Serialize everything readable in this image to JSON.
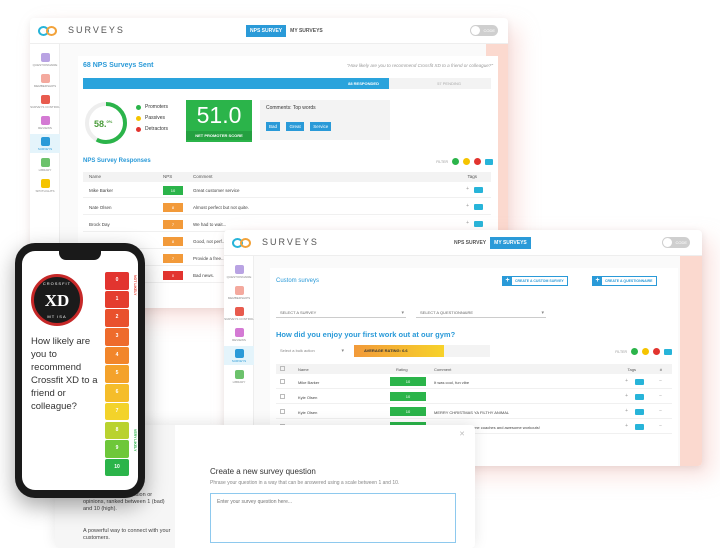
{
  "colors": {
    "accent": "#2a9ad8",
    "promoters": "#2bb44a",
    "passives": "#f5c400",
    "detractors": "#e2342f",
    "logo_blue": "#27b4d9",
    "logo_orange": "#f2a23a"
  },
  "window1": {
    "app_title": "SURVEYS",
    "tabs": [
      {
        "label": "NPS SURVEY",
        "active": true
      },
      {
        "label": "MY SURVEYS",
        "active": false
      }
    ],
    "toggle_label": "CODE",
    "sidebar": [
      {
        "label": "QUESTIONNAIRE",
        "icon": "plus-icon",
        "color": "#b9a3e3"
      },
      {
        "label": "MEMBERSHIPS",
        "icon": "users-icon",
        "color": "#f4a99e"
      },
      {
        "label": "SURVEYS CONTROL",
        "icon": "pdf-icon",
        "color": "#e85b4e"
      },
      {
        "label": "REVIEWS",
        "icon": "thumbs-up-icon",
        "color": "#d47ad4"
      },
      {
        "label": "SURVEYS",
        "icon": "chart-icon",
        "color": "#2a9ad8",
        "active": true
      },
      {
        "label": "LIBRARY",
        "icon": "refresh-icon",
        "color": "#6cc26c"
      },
      {
        "label": "SPOTLIGHTS",
        "icon": "star-icon",
        "color": "#f5c400"
      }
    ],
    "sent_title": "68 NPS Surveys Sent",
    "question": "\"How likely are you to recommend Crossfit XD to a friend or colleague?\"",
    "responded_label": "88 RESPONDED",
    "pending_label": "57 PENDING",
    "responded_fraction": 0.75,
    "gauge_value": "58.",
    "gauge_sup": "0%",
    "gauge_fraction": 0.58,
    "legend": [
      {
        "label": "Promoters",
        "color": "#2bb44a"
      },
      {
        "label": "Passives",
        "color": "#f5c400"
      },
      {
        "label": "Detractors",
        "color": "#e2342f"
      }
    ],
    "nps_value": "51.0",
    "nps_label": "NET PROMOTER SCORE",
    "words_title": "Comments: Top words",
    "words": [
      "Bad",
      "Great",
      "Service"
    ],
    "responses_title": "NPS Survey Responses",
    "filter_label": "FILTER",
    "columns": {
      "name": "Name",
      "nps": "NPS",
      "comment": "Comment",
      "tags": "Tags"
    },
    "rows": [
      {
        "name": "Mike Barker",
        "score": "10",
        "color": "#2bb44a",
        "comment": "Great customer service"
      },
      {
        "name": "Nate Olsen",
        "score": "8",
        "color": "#f29a3a",
        "comment": "Almost perfect but not quite."
      },
      {
        "name": "Brock Day",
        "score": "7",
        "color": "#f29a3a",
        "comment": "We had to wait..."
      },
      {
        "name": "",
        "score": "8",
        "color": "#f29a3a",
        "comment": "Good, not perf..."
      },
      {
        "name": "",
        "score": "7",
        "color": "#f29a3a",
        "comment": "Provide a free..."
      },
      {
        "name": "",
        "score": "0",
        "color": "#e2342f",
        "comment": "Bad news."
      }
    ]
  },
  "window2": {
    "app_title": "SURVEYS",
    "tabs": [
      {
        "label": "NPS SURVEY",
        "active": false
      },
      {
        "label": "MY SURVEYS",
        "active": true
      }
    ],
    "toggle_label": "CODE",
    "sidebar": [
      {
        "label": "QUESTIONNAIRE",
        "icon": "plus-icon",
        "color": "#b9a3e3"
      },
      {
        "label": "MEMBERSHIPS",
        "icon": "users-icon",
        "color": "#f4a99e"
      },
      {
        "label": "SURVEYS CONTROL",
        "icon": "pdf-icon",
        "color": "#e85b4e"
      },
      {
        "label": "REVIEWS",
        "icon": "thumbs-up-icon",
        "color": "#d47ad4"
      },
      {
        "label": "SURVEYS",
        "icon": "chart-icon",
        "color": "#2a9ad8",
        "active": true
      },
      {
        "label": "LIBRARY",
        "icon": "refresh-icon",
        "color": "#6cc26c"
      }
    ],
    "title": "Custom surveys",
    "create_survey": "CREATE A CUSTOM SURVEY",
    "create_questionnaire": "CREATE A QUESTIONNAIRE",
    "select_survey": "SELECT A SURVEY",
    "select_questionnaire": "SELECT A QUESTIONNAIRE",
    "question": "How did you enjoy your first work out at our gym?",
    "bulk_action": "Select a bulk action",
    "average_label": "AVERAGE RATING: 6.6",
    "average_fraction": 0.66,
    "filter_label": "FILTER",
    "columns": {
      "name": "Name",
      "rating": "Rating",
      "comment": "Comment",
      "tags": "Tags",
      "more": "#"
    },
    "rows": [
      {
        "name": "Mike Barker",
        "rating": "10",
        "comment": "It was cool, fun vibe"
      },
      {
        "name": "Kyle Olsen",
        "rating": "10",
        "comment": ""
      },
      {
        "name": "Kyle Olsen",
        "rating": "10",
        "comment": "MERRY CHRISTMAS YA FILTHY ANIMAL"
      },
      {
        "name": "",
        "rating": "",
        "comment": "Awesome gym. Awesome coaches and awesome workouts!"
      }
    ]
  },
  "window3": {
    "bullets": [
      {
        "text": "A gathering of information or opinions, ranked between 1 (bad) and 10 (high)."
      },
      {
        "text": "A powerful way to connect with your customers."
      }
    ],
    "title": "Create a new survey question",
    "subtitle": "Phrase your question in a way that can be answered using a scale between 1 and 10.",
    "placeholder": "Enter your survey question here..."
  },
  "phone": {
    "badge_top": "CROSSFIT",
    "badge_main": "XD",
    "badge_bottom": "MT ISA",
    "question": "How likely are you to recommend Crossfit XD to a friend or colleague?",
    "scale": [
      {
        "value": "0",
        "color": "#e2342f"
      },
      {
        "value": "1",
        "color": "#e43d2e"
      },
      {
        "value": "2",
        "color": "#e9512d"
      },
      {
        "value": "3",
        "color": "#ee6b2c"
      },
      {
        "value": "4",
        "color": "#f2862b"
      },
      {
        "value": "5",
        "color": "#f4a22b"
      },
      {
        "value": "6",
        "color": "#f5bd2a"
      },
      {
        "value": "7",
        "color": "#f3d32a"
      },
      {
        "value": "8",
        "color": "#b9d22f"
      },
      {
        "value": "9",
        "color": "#6ec73a"
      },
      {
        "value": "10",
        "color": "#2bb44a"
      }
    ],
    "label_top": "NOT LIKELY",
    "label_bottom": "VERY LIKELY"
  }
}
